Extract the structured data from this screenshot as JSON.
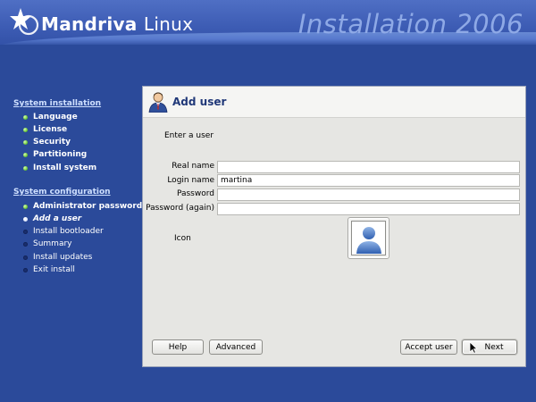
{
  "banner": {
    "brand_bold": "Mandriva",
    "brand_thin": "Linux",
    "title": "Installation 2006"
  },
  "sidebar": {
    "sections": [
      {
        "title": "System installation",
        "steps": [
          {
            "label": "Language",
            "state": "done"
          },
          {
            "label": "License",
            "state": "done"
          },
          {
            "label": "Security",
            "state": "done"
          },
          {
            "label": "Partitioning",
            "state": "done"
          },
          {
            "label": "Install system",
            "state": "done"
          }
        ]
      },
      {
        "title": "System configuration",
        "steps": [
          {
            "label": "Administrator password",
            "state": "done"
          },
          {
            "label": "Add a user",
            "state": "current"
          },
          {
            "label": "Install bootloader",
            "state": "todo"
          },
          {
            "label": "Summary",
            "state": "todo"
          },
          {
            "label": "Install updates",
            "state": "todo"
          },
          {
            "label": "Exit install",
            "state": "todo"
          }
        ]
      }
    ]
  },
  "panel": {
    "title": "Add user",
    "subtitle": "Enter a user",
    "fields": [
      {
        "label": "Real name",
        "value": ""
      },
      {
        "label": "Login name",
        "value": "martina"
      },
      {
        "label": "Password",
        "value": ""
      },
      {
        "label": "Password (again)",
        "value": ""
      }
    ],
    "icon_label": "Icon"
  },
  "buttons": {
    "help": "Help",
    "advanced": "Advanced",
    "accept_user": "Accept user",
    "next": "Next"
  },
  "colors": {
    "background": "#2b4a9a",
    "panel": "#e6e6e3",
    "header_title": "#203878",
    "done_bullet": "#5fbf2a"
  }
}
